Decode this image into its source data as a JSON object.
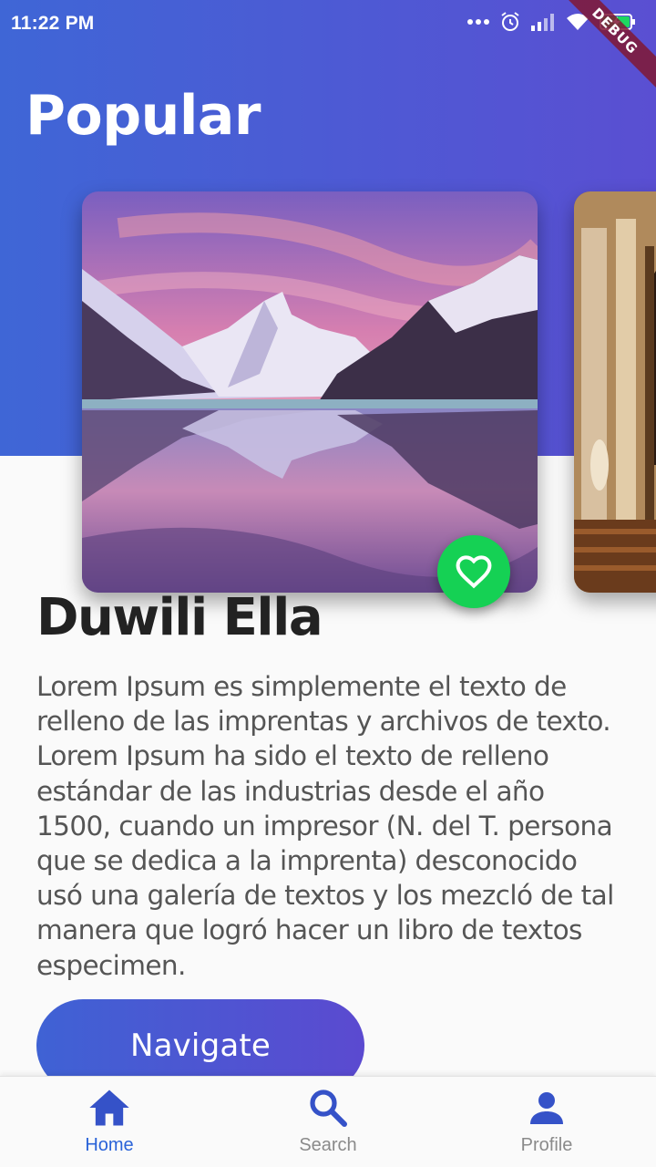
{
  "status_bar": {
    "time": "11:22 PM"
  },
  "debug_banner": "DEBUG",
  "header": {
    "title": "Popular"
  },
  "detail": {
    "title": "Duwili Ella",
    "description": "Lorem Ipsum es simplemente el texto de relleno de las imprentas y archivos de texto. Lorem Ipsum ha sido el texto de relleno estándar de las industrias desde el año 1500, cuando un impresor (N. del T. persona que se dedica a la imprenta) desconocido usó una galería de textos y los mezcló de tal manera que logró hacer un libro de textos especimen."
  },
  "actions": {
    "navigate_label": "Navigate"
  },
  "bottom_nav": {
    "items": [
      {
        "label": "Home",
        "icon": "home-icon",
        "active": true
      },
      {
        "label": "Search",
        "icon": "search-icon",
        "active": false
      },
      {
        "label": "Profile",
        "icon": "profile-icon",
        "active": false
      }
    ]
  },
  "colors": {
    "header_gradient_start": "#3f66d6",
    "header_gradient_end": "#5a4fd2",
    "favorite_button": "#15d154",
    "active_nav": "#2a63d8",
    "inactive_nav": "#8a8a8a"
  }
}
